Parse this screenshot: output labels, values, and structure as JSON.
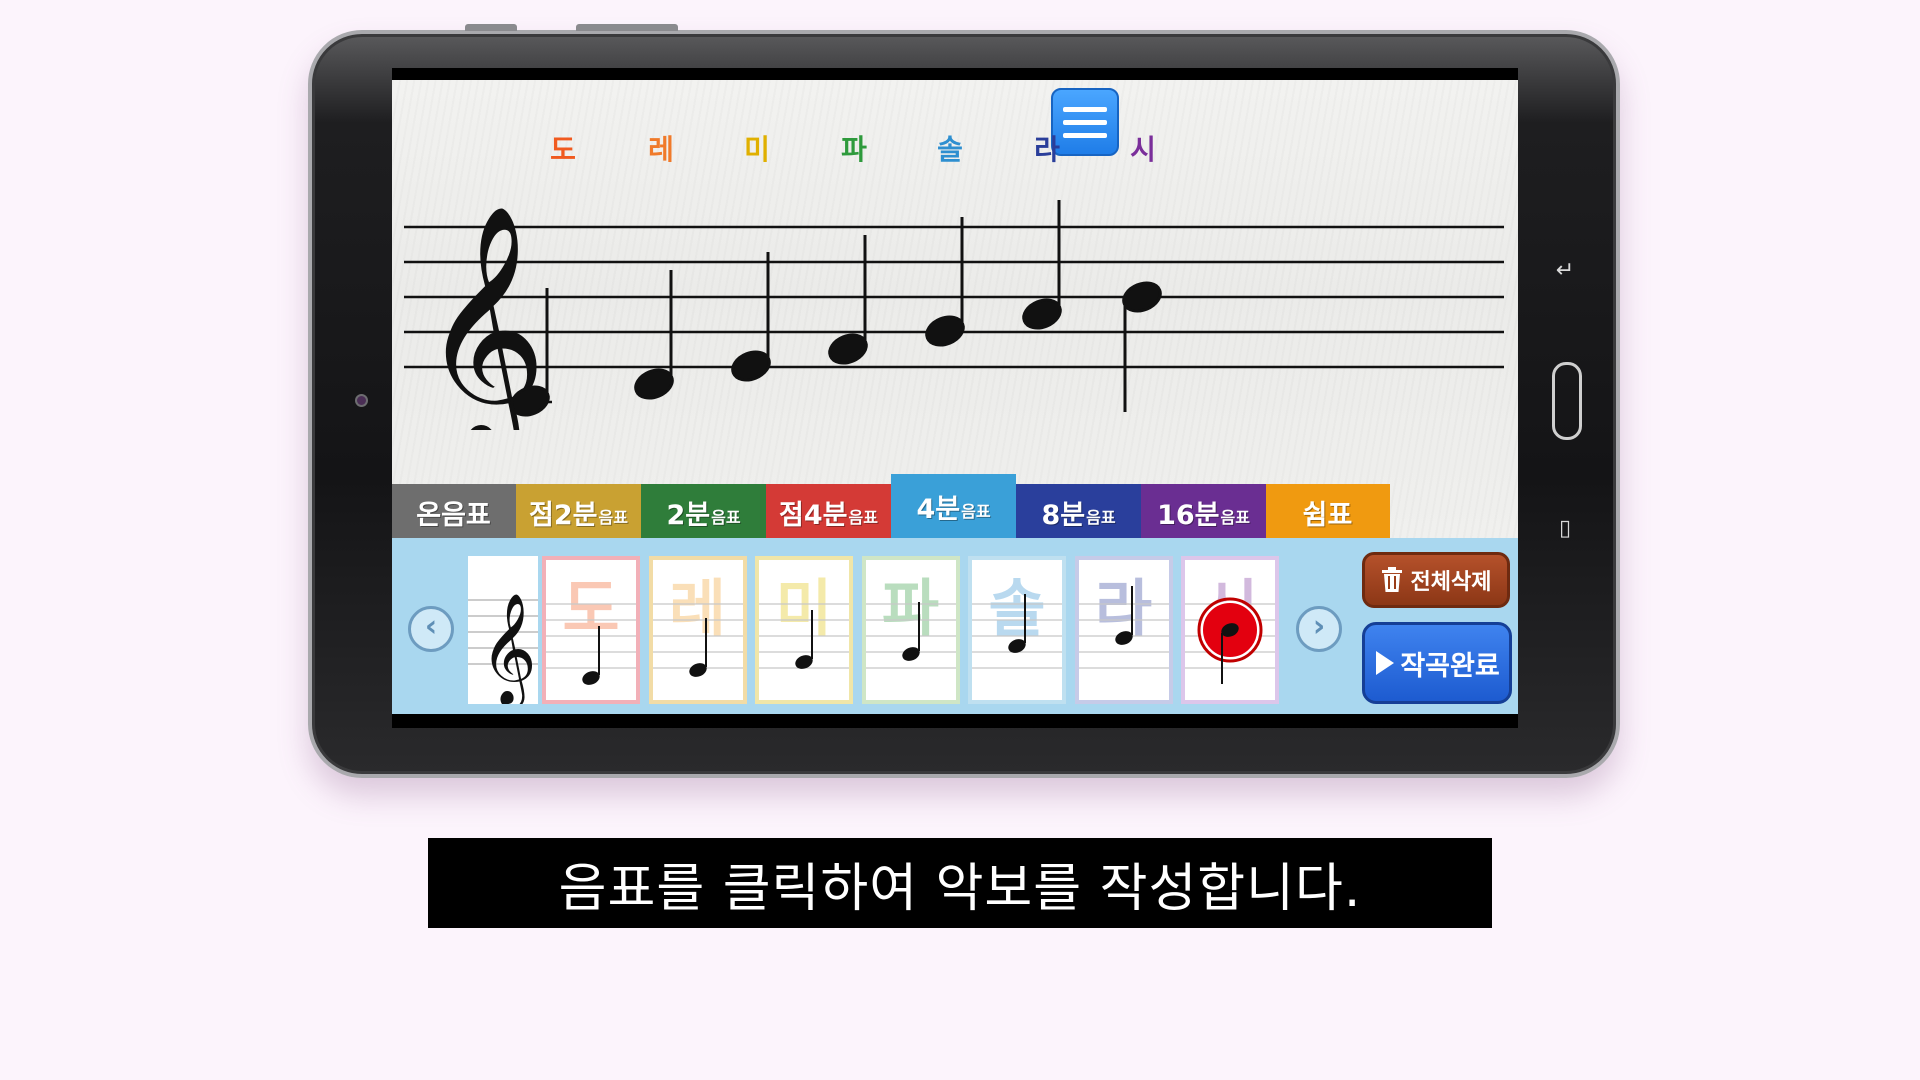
{
  "solfege": [
    {
      "label": "도",
      "color": "#f05a1f"
    },
    {
      "label": "레",
      "color": "#f07a2a"
    },
    {
      "label": "미",
      "color": "#e0b000"
    },
    {
      "label": "파",
      "color": "#2e9a3c"
    },
    {
      "label": "솔",
      "color": "#2e8fd0"
    },
    {
      "label": "라",
      "color": "#2a3e9a"
    },
    {
      "label": "시",
      "color": "#7a2e9a"
    }
  ],
  "tabs": [
    {
      "main": "온음표",
      "sub": "",
      "color": "#6e6e6e"
    },
    {
      "main": "점2분",
      "sub": "음표",
      "color": "#c9a132"
    },
    {
      "main": "2분",
      "sub": "음표",
      "color": "#2f7d3a"
    },
    {
      "main": "점4분",
      "sub": "음표",
      "color": "#d43a36"
    },
    {
      "main": "4분",
      "sub": "음표",
      "color": "#3aa0d8"
    },
    {
      "main": "8분",
      "sub": "음표",
      "color": "#2a3f9c"
    },
    {
      "main": "16분",
      "sub": "음표",
      "color": "#6a2e92"
    },
    {
      "main": "쉼표",
      "sub": "",
      "color": "#f09a10"
    }
  ],
  "active_tab": "4분",
  "palette": {
    "prev_icon": "‹",
    "next_icon": "›",
    "notes": [
      {
        "label": "도",
        "color": "#f05a1f",
        "border": "#f2b0b8"
      },
      {
        "label": "레",
        "color": "#f0a02a",
        "border": "#f2dca6"
      },
      {
        "label": "미",
        "color": "#e0c000",
        "border": "#f0e6a8"
      },
      {
        "label": "파",
        "color": "#2e9a3c",
        "border": "#cfe6c6"
      },
      {
        "label": "솔",
        "color": "#2e8fd0",
        "border": "#bfe0f0"
      },
      {
        "label": "라",
        "color": "#2a3e9a",
        "border": "#c6cbe8"
      },
      {
        "label": "시",
        "color": "#7a2e9a",
        "border": "#dcc6ea"
      }
    ],
    "selected_note": "시"
  },
  "buttons": {
    "clear_label": "전체삭제",
    "done_label": "작곡완료",
    "clear_icon": "trash-icon",
    "done_icon": "play-icon"
  },
  "device": {
    "back_icon": "↵",
    "recent_icon": "▯"
  },
  "caption": "음표를 클릭하여 악보를 작성합니다."
}
